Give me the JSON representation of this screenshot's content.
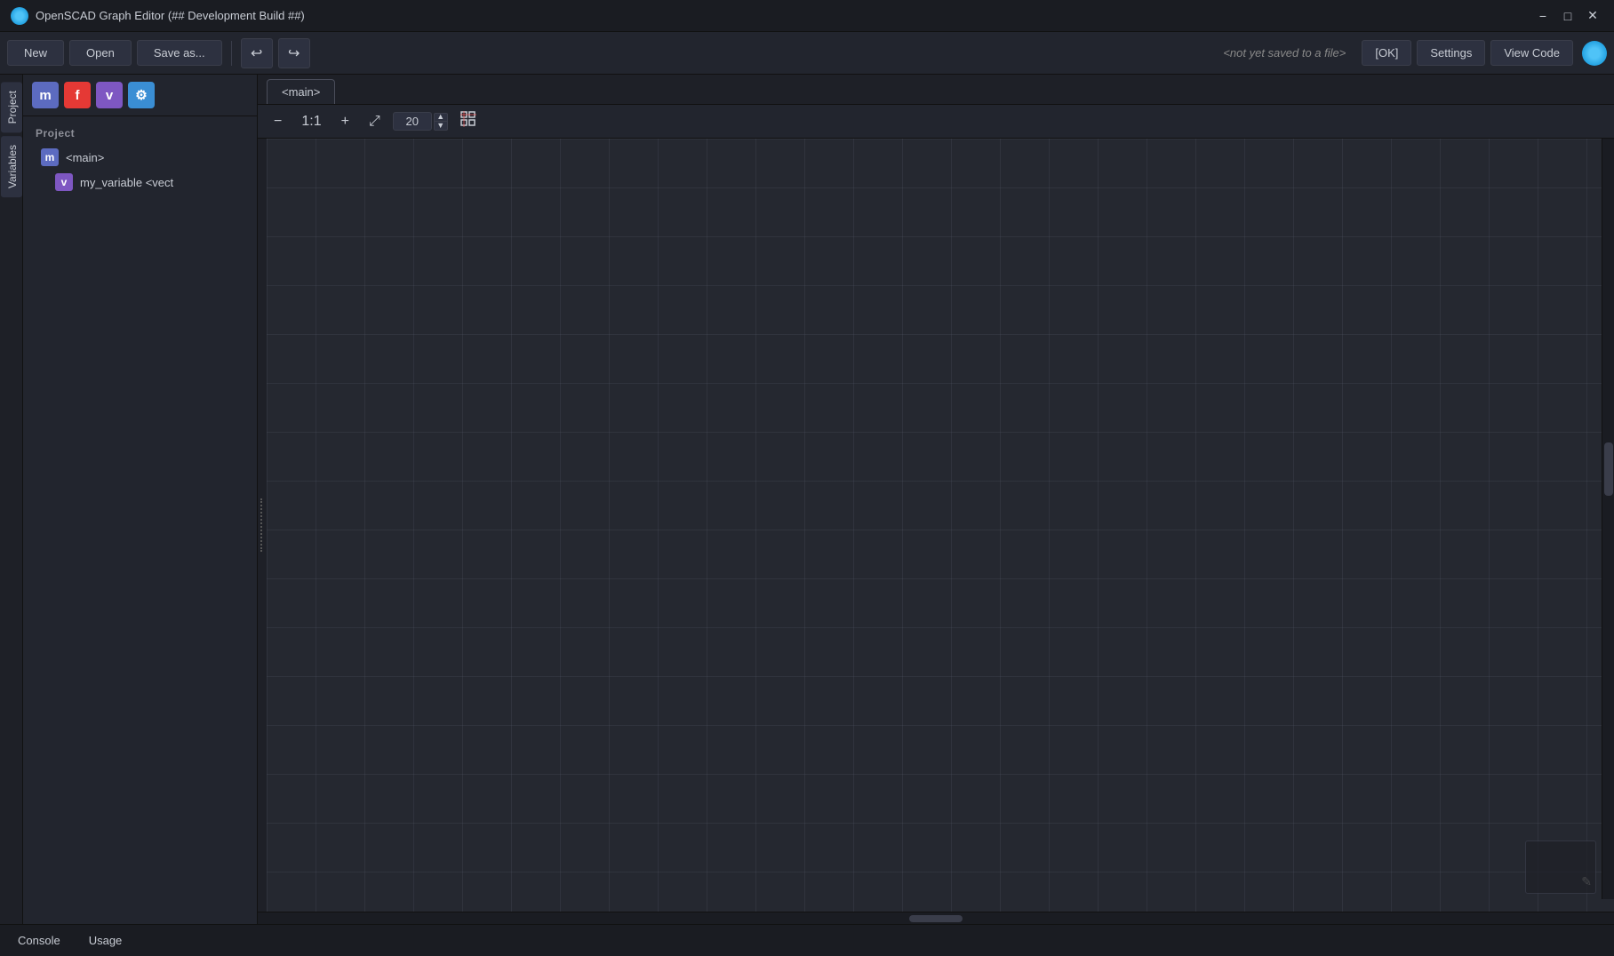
{
  "titlebar": {
    "title": "OpenSCAD Graph Editor (## Development Build ##)",
    "controls": {
      "minimize": "−",
      "maximize": "□",
      "close": "✕"
    }
  },
  "toolbar": {
    "new_label": "New",
    "open_label": "Open",
    "save_as_label": "Save as...",
    "undo_label": "↩",
    "redo_label": "↪",
    "status_text": "<not yet saved to a file>",
    "ok_label": "[OK]",
    "settings_label": "Settings",
    "view_code_label": "View Code"
  },
  "side_tabs": {
    "project_label": "Project",
    "variables_label": "Variables"
  },
  "node_types": {
    "m_label": "m",
    "r_label": "f",
    "v_label": "v",
    "gear_label": "⚙"
  },
  "project_tree": {
    "section_label": "Project",
    "items": [
      {
        "icon": "m",
        "label": "<main>"
      },
      {
        "icon": "v",
        "label": "my_variable <vect"
      }
    ]
  },
  "tabs": [
    {
      "label": "<main>",
      "active": true
    }
  ],
  "canvas_toolbar": {
    "zoom_out_label": "−",
    "one_to_one_label": "1:1",
    "zoom_in_label": "+",
    "fit_label": "⤢",
    "zoom_value": "20",
    "grid_label": "⊞"
  },
  "bottom_tabs": [
    {
      "label": "Console",
      "active": false
    },
    {
      "label": "Usage",
      "active": false
    }
  ]
}
